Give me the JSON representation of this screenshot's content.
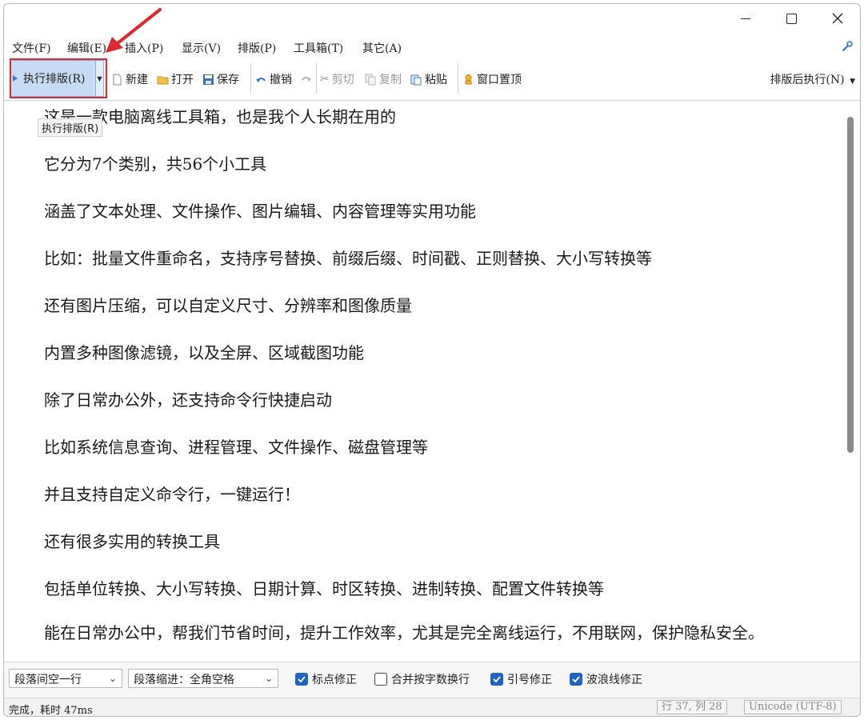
{
  "menubar": {
    "items": [
      "文件(F)",
      "编辑(E)",
      "插入(P)",
      "显示(V)",
      "排版(P)",
      "工具箱(T)",
      "其它(A)"
    ]
  },
  "toolbar": {
    "run_label": "执行排版(R)",
    "new_label": "新建",
    "open_label": "打开",
    "save_label": "保存",
    "undo_label": "撤销",
    "cut_label": "剪切",
    "copy_label": "复制",
    "paste_label": "粘贴",
    "pin_label": "窗口置顶",
    "after_run_label": "排版后执行(N)"
  },
  "tooltip": "执行排版(R)",
  "editor": {
    "paragraphs": [
      "这是一款电脑离线工具箱，也是我个人长期在用的",
      "它分为7个类别，共56个小工具",
      "涵盖了文本处理、文件操作、图片编辑、内容管理等实用功能",
      "比如：批量文件重命名，支持序号替换、前缀后缀、时间戳、正则替换、大小写转换等",
      "还有图片压缩，可以自定义尺寸、分辨率和图像质量",
      "内置多种图像滤镜，以及全屏、区域截图功能",
      "除了日常办公外，还支持命令行快捷启动",
      "比如系统信息查询、进程管理、文件操作、磁盘管理等",
      "并且支持自定义命令行，一键运行！",
      "还有很多实用的转换工具",
      "包括单位转换、大小写转换、日期计算、时区转换、进制转换、配置文件转换等",
      "能在日常办公中，帮我们节省时间，提升工作效率，尤其是完全离线运行，不用联网，保护隐私安全。"
    ]
  },
  "options": {
    "para_spacing": "段落间空一行",
    "para_indent": "段落缩进：全角空格",
    "checks": [
      {
        "label": "标点修正",
        "checked": true
      },
      {
        "label": "合并按字数换行",
        "checked": false
      },
      {
        "label": "引号修正",
        "checked": true
      },
      {
        "label": "波浪线修正",
        "checked": true
      }
    ]
  },
  "status": {
    "message": "完成，耗时 47ms",
    "position": "行 37, 列 28",
    "encoding": "Unicode (UTF-8)"
  },
  "colors": {
    "highlight": "#e1262f",
    "accent": "#1d63c8",
    "run_button_bg": "#c6dcf4"
  }
}
